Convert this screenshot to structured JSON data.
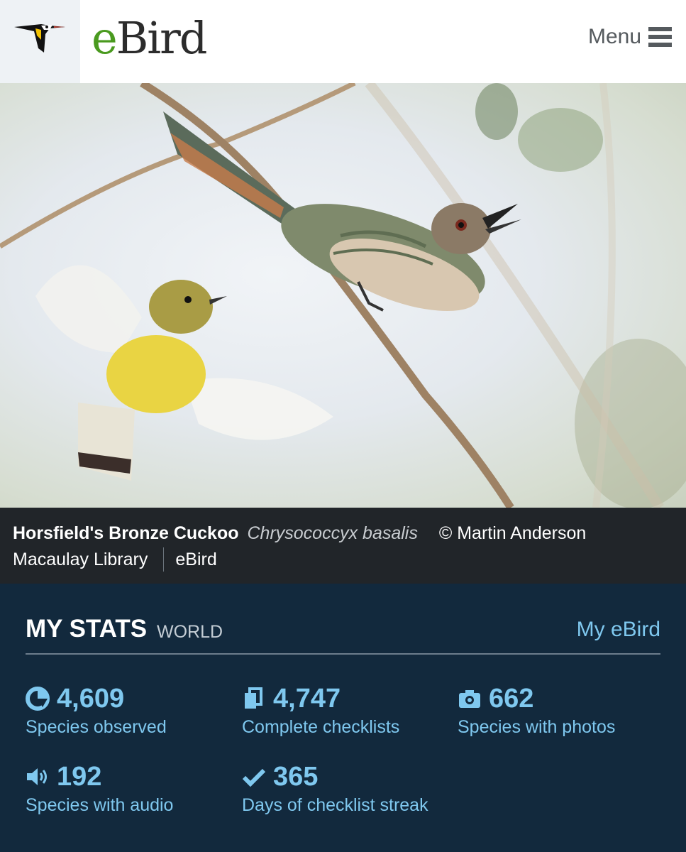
{
  "header": {
    "brand_e": "e",
    "brand_rest": "Bird",
    "menu_label": "Menu",
    "logo_icon": "ebird-logo-icon",
    "menu_icon": "hamburger-icon"
  },
  "photo": {
    "common_name": "Horsfield's Bronze Cuckoo",
    "scientific_name": "Chrysococcyx basalis",
    "credit": "© Martin Anderson",
    "links": [
      "Macaulay Library",
      "eBird"
    ]
  },
  "stats": {
    "title": "MY STATS",
    "scope": "WORLD",
    "my_ebird_link": "My eBird",
    "items": [
      {
        "icon": "species-pie-icon",
        "value": "4,609",
        "label": "Species observed"
      },
      {
        "icon": "checklist-icon",
        "value": "4,747",
        "label": "Complete checklists"
      },
      {
        "icon": "camera-icon",
        "value": "662",
        "label": "Species with photos"
      },
      {
        "icon": "speaker-icon",
        "value": "192",
        "label": "Species with audio"
      },
      {
        "icon": "checkmark-icon",
        "value": "365",
        "label": "Days of checklist streak"
      }
    ]
  },
  "colors": {
    "brand_green": "#4a9a1f",
    "caption_bg": "#212529",
    "stats_bg": "#12293d",
    "stats_accent": "#7fc8ef"
  }
}
